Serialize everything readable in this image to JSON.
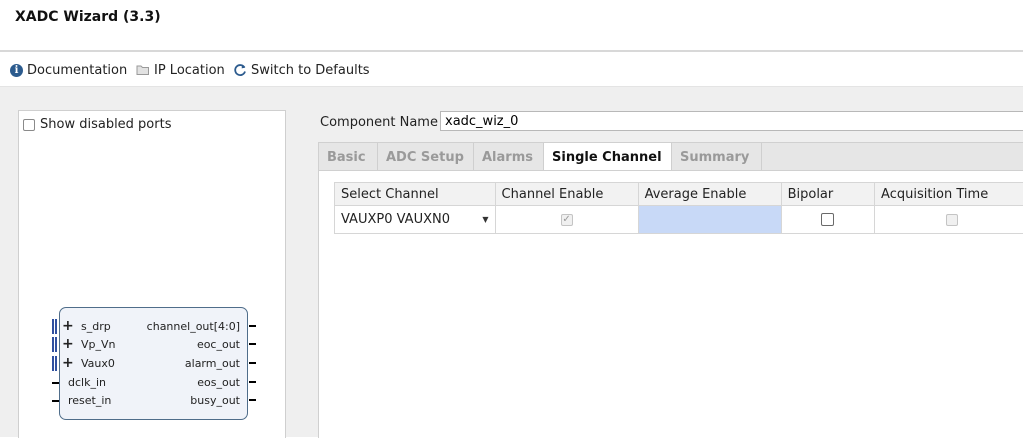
{
  "window": {
    "title": "XADC Wizard (3.3)"
  },
  "toolbar": {
    "documentation": "Documentation",
    "ip_location": "IP Location",
    "switch_defaults": "Switch to Defaults"
  },
  "left_panel": {
    "show_disabled_ports": "Show disabled ports",
    "symbol": {
      "inputs": [
        "s_drp",
        "Vp_Vn",
        "Vaux0",
        "dclk_in",
        "reset_in"
      ],
      "outputs": [
        "channel_out[4:0]",
        "eoc_out",
        "alarm_out",
        "eos_out",
        "busy_out"
      ]
    }
  },
  "component": {
    "label": "Component Name",
    "value": "xadc_wiz_0"
  },
  "tabs": [
    "Basic",
    "ADC Setup",
    "Alarms",
    "Single Channel",
    "Summary"
  ],
  "active_tab": "Single Channel",
  "table": {
    "headers": [
      "Select Channel",
      "Channel Enable",
      "Average Enable",
      "Bipolar",
      "Acquisition Time"
    ],
    "row": {
      "select_channel": "VAUXP0 VAUXN0",
      "channel_enable": true,
      "bipolar": false,
      "acquisition_time": false
    }
  },
  "icons": {
    "documentation": "info-icon",
    "ip_location": "folder-icon",
    "switch_defaults": "refresh-icon"
  },
  "colors": {
    "selected_cell": "#c8d9f7",
    "symbol_border": "#4f6d8a"
  }
}
